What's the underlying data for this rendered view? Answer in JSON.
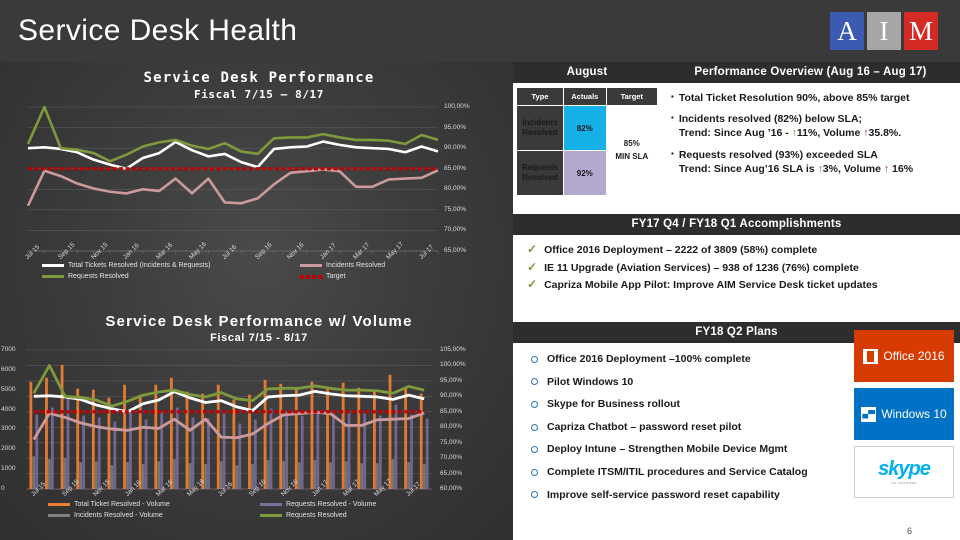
{
  "header": {
    "title": "Service Desk Health",
    "logo": {
      "a": "A",
      "i": "I",
      "m": "M"
    }
  },
  "august_panel": {
    "heading": "August",
    "columns": [
      "Type",
      "Actuals",
      "Target"
    ],
    "rows": [
      {
        "type": "Incidents Resolved",
        "actual": "82%"
      },
      {
        "type": "Requests Resolved",
        "actual": "92%"
      }
    ],
    "target_value": "85%",
    "target_note": "MIN SLA",
    "colors": {
      "incident_cell": "#16b0e8",
      "request_cell": "#b3a9cf"
    }
  },
  "performance_overview": {
    "heading": "Performance Overview (Aug 16 – Aug 17)",
    "bullets": [
      {
        "line1": "Total Ticket Resolution 90%, above 85%  target",
        "line2": ""
      },
      {
        "line1": "Incidents resolved (82%) below SLA;",
        "line2_a": "Trend: Since Aug ’16 -",
        "pct": "11%",
        "line2_b": ", Volume",
        "vol": "35.8%."
      },
      {
        "line1": "Requests resolved (93%) exceeded SLA",
        "line2_a": "Trend: Since Aug’16 SLA is",
        "pct": "3%",
        "line2_b": ", Volume",
        "vol": " 16%"
      }
    ]
  },
  "accomplishments": {
    "heading": "FY17 Q4 / FY18 Q1 Accomplishments",
    "items": [
      "Office 2016 Deployment – 2222 of 3809 (58%) complete",
      "IE 11 Upgrade (Aviation Services) – 938 of 1236 (76%) complete",
      "Capriza Mobile App Pilot: Improve AIM Service Desk ticket updates"
    ]
  },
  "plans": {
    "heading": "FY18 Q2 Plans",
    "items": [
      "Office 2016 Deployment –100% complete",
      "Pilot Windows 10",
      "Skype for Business rollout",
      "Capriza Chatbot – password reset pilot",
      "Deploy Intune – Strengthen Mobile Device Mgmt",
      "Complete ITSM/ITIL procedures and Service Catalog",
      "Improve self-service password reset capability"
    ],
    "logo_cards": [
      {
        "label": "Office 2016",
        "color": "#d83b01"
      },
      {
        "label": "Windows 10",
        "color": "#0072c6"
      },
      {
        "label": "skype",
        "sub": "for business",
        "color": "#00aff0"
      }
    ]
  },
  "page_number": "6",
  "chart_data": [
    {
      "type": "line",
      "title": "Service Desk Performance",
      "subtitle": "Fiscal 7/15 – 8/17",
      "xlabel": "",
      "ylabel": "",
      "ylim": [
        65,
        100
      ],
      "yticks": [
        "100,00%",
        "95,00%",
        "90,00%",
        "85,00%",
        "80,00%",
        "75,00%",
        "70,00%",
        "65,00%"
      ],
      "grid": true,
      "legend_position": "bottom",
      "categories": [
        "Jul 15",
        "Aug 15",
        "Sep 15",
        "Oct 15",
        "Nov 15",
        "Dec 15",
        "Jan 16",
        "Feb 16",
        "Mar 16",
        "Apr 16",
        "May 16",
        "Jun 16",
        "Jul 16",
        "Aug 16",
        "Sep 16",
        "Oct 16",
        "Nov 16",
        "Dec 16",
        "Jan 17",
        "Feb 17",
        "Mar 17",
        "Apr 17",
        "May 17",
        "Jun 17",
        "Jul 17",
        "Aug 17"
      ],
      "tick_labels": [
        "Jul 15",
        "Sep 15",
        "Nov 15",
        "Jan 16",
        "Mar 16",
        "May 16",
        "Jul 16",
        "Sep 16",
        "Nov 16",
        "Jan 17",
        "Mar 17",
        "May 17",
        "Jul 17"
      ],
      "series": [
        {
          "name": "Total Tickets Resolved  (Incidents & Requests)",
          "color": "#ffffff",
          "values": [
            90.0,
            90.2,
            89.8,
            89.0,
            87.2,
            86.0,
            85.0,
            87.6,
            88.8,
            91.5,
            89.5,
            88.0,
            88.6,
            86.6,
            85.4,
            89.8,
            90.2,
            90.4,
            91.6,
            90.8,
            90.2,
            90.0,
            89.8,
            89.0,
            90.4,
            89.2
          ]
        },
        {
          "name": "Incidents Resolved",
          "color": "#cc9a9a",
          "values": [
            76.0,
            84.5,
            83.2,
            81.4,
            80.2,
            79.4,
            79.0,
            80.0,
            79.6,
            82.6,
            79.0,
            82.6,
            76.8,
            76.6,
            77.8,
            81.2,
            84.0,
            84.4,
            84.8,
            84.4,
            80.6,
            80.6,
            82.4,
            82.6,
            82.8,
            84.6
          ]
        },
        {
          "name": "Requests Resolved",
          "color": "#7f9a3c",
          "values": [
            91.0,
            100.0,
            90.0,
            89.6,
            88.8,
            86.8,
            88.4,
            90.4,
            91.4,
            92.0,
            90.6,
            89.8,
            91.2,
            89.2,
            88.6,
            92.4,
            92.6,
            92.6,
            93.4,
            92.6,
            92.0,
            92.0,
            91.8,
            91.0,
            93.2,
            92.0
          ]
        },
        {
          "name": "Target",
          "color": "#c00000",
          "style": "dashed",
          "values": [
            85,
            85,
            85,
            85,
            85,
            85,
            85,
            85,
            85,
            85,
            85,
            85,
            85,
            85,
            85,
            85,
            85,
            85,
            85,
            85,
            85,
            85,
            85,
            85,
            85,
            85
          ]
        }
      ]
    },
    {
      "type": "line",
      "title": "Service Desk Performance w/ Volume",
      "subtitle": "Fiscal 7/15 - 8/17",
      "xlabel": "",
      "ylabel": "",
      "ylim_left": [
        0,
        7000
      ],
      "yticks_left": [
        "7000",
        "6000",
        "5000",
        "4000",
        "3000",
        "2000",
        "1000",
        "0"
      ],
      "ylim_right": [
        60,
        105
      ],
      "yticks_right": [
        "105,00%",
        "100,00%",
        "95,00%",
        "90,00%",
        "85,00%",
        "80,00%",
        "75,00%",
        "70,00%",
        "65,00%",
        "60,00%"
      ],
      "grid": true,
      "legend_position": "bottom",
      "tick_labels": [
        "Jul 15",
        "Sep 15",
        "Nov 15",
        "Jan 16",
        "Mar 16",
        "May 16",
        "Jul 16",
        "Sep 16",
        "Nov 16",
        "Jan 17",
        "Mar 17",
        "May 17",
        "Jul 17"
      ],
      "series": [
        {
          "name": "Total Ticket Resolved - Volume",
          "color": "#ed7d31",
          "style": "column",
          "values": [
            5400,
            5600,
            6250,
            5050,
            5000,
            4600,
            5250,
            4750,
            5250,
            5600,
            4900,
            4800,
            5250,
            4500,
            4750,
            5500,
            5300,
            5050,
            5400,
            5150,
            5350,
            5100,
            5000,
            5750,
            5100,
            4800
          ]
        },
        {
          "name": "Incidents Resolved - Volume",
          "color": "#808080",
          "style": "column",
          "values": [
            1650,
            1500,
            1550,
            1350,
            1400,
            1200,
            1350,
            1250,
            1400,
            1500,
            1300,
            1250,
            1400,
            1200,
            1250,
            1450,
            1400,
            1350,
            1450,
            1350,
            1400,
            1300,
            1300,
            1500,
            1350,
            1250
          ]
        },
        {
          "name": "Requests Resolved - Volume",
          "color": "#7b6f9e",
          "style": "column",
          "values": [
            3750,
            4100,
            4700,
            3700,
            3600,
            3400,
            3900,
            3500,
            3850,
            4100,
            3600,
            3550,
            3850,
            3300,
            3500,
            4050,
            3900,
            3700,
            3950,
            3800,
            3950,
            3800,
            3700,
            4250,
            3750,
            3550
          ]
        },
        {
          "name": "Requests Resolved",
          "color": "#7f9a3c",
          "style": "line",
          "values": [
            91.0,
            100.0,
            90.0,
            89.6,
            88.8,
            86.8,
            88.4,
            90.4,
            91.4,
            92.0,
            90.6,
            89.8,
            91.2,
            89.2,
            88.6,
            92.4,
            92.6,
            92.6,
            93.4,
            92.6,
            92.0,
            92.0,
            91.8,
            91.0,
            93.2,
            92.0
          ]
        }
      ]
    }
  ]
}
